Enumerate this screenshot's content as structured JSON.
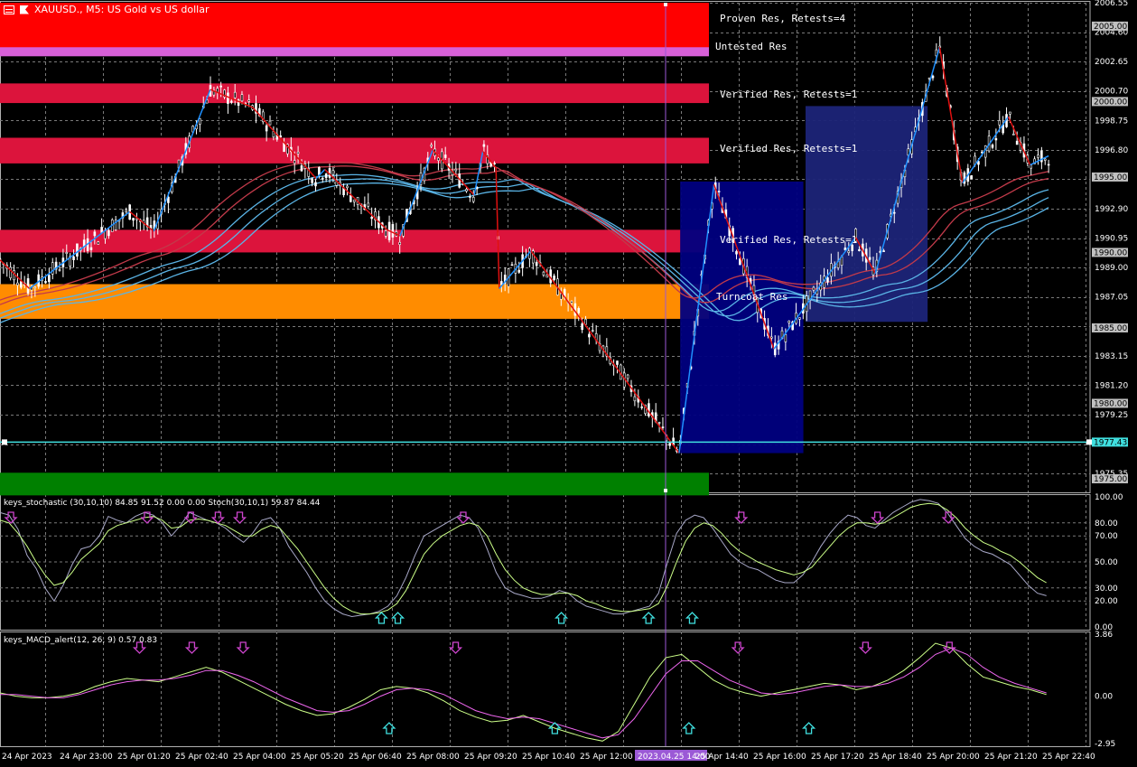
{
  "window": {
    "title": "XAUUSD., M5:  US Gold vs US dollar"
  },
  "colors": {
    "background": "#000000",
    "grid": "#7a7a7a",
    "candle": "#ffffff",
    "zigzag_up": "#1e90ff",
    "zigzag_down": "#e01010",
    "ma_blue": "#5ab4e6",
    "ma_red": "#c23a4a",
    "ma_magenta": "#d03aa0",
    "ma_teal": "#2aa89a",
    "proven_res": "#ff0000",
    "untested_res": "#d860d8",
    "verified_res": "#dc143c",
    "turncoat": "#ff8c00",
    "support_green": "#008000",
    "box_dark": "#00007f",
    "box_light": "#1c2478",
    "hline": "#40e0e0",
    "vline": "#9b59d6",
    "stoch_main": "#a8a8c8",
    "stoch_signal": "#ccff88",
    "arrow_down": "#cc44cc",
    "arrow_up": "#40e0e0",
    "macd_main": "#ccff88",
    "macd_signal": "#ee66ee"
  },
  "chart_data": [
    {
      "type": "candlestick",
      "symbol": "XAUUSD.",
      "timeframe": "M5",
      "ylim": [
        1974.1,
        2006.55
      ],
      "y_ticks": [
        "2006.55",
        "2004.60",
        "2002.65",
        "2000.70",
        "1998.75",
        "1996.80",
        "1994.85",
        "1992.90",
        "1990.95",
        "1989.00",
        "1987.05",
        "1985.10",
        "1983.15",
        "1981.20",
        "1979.25",
        "1977.30",
        "1975.35"
      ],
      "y_ticks_visible": [
        "2006.55",
        "2004.60",
        "2002.65",
        "2000.70",
        "1998.75",
        "1996.80",
        "1992.90",
        "1990.95",
        "1989.00",
        "1987.05",
        "1983.15",
        "1981.20",
        "1979.25",
        "1975.35"
      ],
      "price_labels": [
        {
          "text": "2005.00",
          "value": 2005.0,
          "style": "grey"
        },
        {
          "text": "2000.00",
          "value": 2000.0,
          "style": "grey"
        },
        {
          "text": "1995.00",
          "value": 1995.0,
          "style": "grey"
        },
        {
          "text": "1990.00",
          "value": 1990.0,
          "style": "grey"
        },
        {
          "text": "1985.00",
          "value": 1985.0,
          "style": "grey"
        },
        {
          "text": "1980.00",
          "value": 1980.0,
          "style": "grey"
        },
        {
          "text": "1977.43",
          "value": 1977.43,
          "style": "cyan"
        },
        {
          "text": "1975.00",
          "value": 1975.0,
          "style": "grey"
        }
      ],
      "zones": [
        {
          "label": "Proven Res, Retests=4",
          "from": 2003.1,
          "to": 2006.55,
          "color": "#ff0000"
        },
        {
          "label": "Untested Res",
          "from": 2003.0,
          "to": 2003.6,
          "color": "#d860d8"
        },
        {
          "label": "Verified Res, Retests=1",
          "from": 1999.9,
          "to": 2001.2,
          "color": "#dc143c"
        },
        {
          "label": "Verified Res, Retests=1",
          "from": 1995.9,
          "to": 1997.6,
          "color": "#dc143c"
        },
        {
          "label": "Verified Res, Retests=1",
          "from": 1990.0,
          "to": 1991.5,
          "color": "#dc143c"
        },
        {
          "label": "Turncoat Res",
          "from": 1985.6,
          "to": 1987.9,
          "color": "#ff8c00"
        },
        {
          "label": "",
          "from": 1973.9,
          "to": 1975.4,
          "color": "#008000"
        }
      ],
      "hline": {
        "value": 1977.43,
        "label": "1977.43"
      },
      "zigzag": [
        [
          1985.3,
          1986.3
        ],
        [
          1990.3,
          1987.8
        ],
        [
          1986.8,
          1989.3
        ],
        [
          1990.8,
          1991.7
        ],
        [
          1992.0,
          1993.0
        ],
        [
          1990.9,
          1992.0
        ],
        [
          1986.7,
          1988.1
        ],
        [
          1993.3,
          1995.3
        ],
        [
          1990.5,
          1991.3
        ],
        [
          1996.6,
          1997.1
        ],
        [
          1995.0,
          1994.3
        ]
      ],
      "zigzag_points": [
        {
          "t": 0.0,
          "v": 1989.5
        },
        {
          "t": 0.027,
          "v": 1987.6
        },
        {
          "t": 0.119,
          "v": 1992.7
        },
        {
          "t": 0.141,
          "v": 1991.4
        },
        {
          "t": 0.193,
          "v": 2000.8
        },
        {
          "t": 0.232,
          "v": 1999.6
        },
        {
          "t": 0.29,
          "v": 1994.9
        },
        {
          "t": 0.298,
          "v": 1995.5
        },
        {
          "t": 0.355,
          "v": 1991.5
        },
        {
          "t": 0.367,
          "v": 1991.1
        },
        {
          "t": 0.397,
          "v": 1996.8
        },
        {
          "t": 0.435,
          "v": 1993.8
        },
        {
          "t": 0.443,
          "v": 1996.7
        },
        {
          "t": 0.455,
          "v": 1995.6
        },
        {
          "t": 0.458,
          "v": 1987.6
        },
        {
          "t": 0.487,
          "v": 1990.1
        },
        {
          "t": 0.623,
          "v": 1976.7
        },
        {
          "t": 0.655,
          "v": 1994.5
        },
        {
          "t": 0.71,
          "v": 1983.6
        },
        {
          "t": 0.785,
          "v": 1991.0
        },
        {
          "t": 0.803,
          "v": 1988.6
        },
        {
          "t": 0.862,
          "v": 2003.6
        },
        {
          "t": 0.883,
          "v": 1994.6
        },
        {
          "t": 0.925,
          "v": 1999.0
        },
        {
          "t": 0.945,
          "v": 1995.8
        },
        {
          "t": 0.962,
          "v": 1996.4
        }
      ],
      "boxes": [
        {
          "from": "2023.04.25 14:00",
          "t0": 0.624,
          "t1": 0.737,
          "low": 1976.7,
          "high": 1994.7,
          "color": "#00007f"
        },
        {
          "t0": 0.739,
          "t1": 0.851,
          "low": 1985.4,
          "high": 1999.7,
          "color": "#1c2478"
        }
      ],
      "vline": {
        "t": 0.586,
        "label": "2023.04.25 14:00"
      }
    },
    {
      "type": "line",
      "name": "keys_stochastic (30,10,10) 84.85 91.52 0.00 0.00 Stoch(30,10,1) 59.87 84.44",
      "ylim": [
        0,
        100
      ],
      "y_ticks": [
        "100.00",
        "80.00",
        "70.00",
        "50.00",
        "30.00",
        "20.00",
        "0.00"
      ],
      "main": [
        88,
        86,
        75,
        55,
        45,
        30,
        20,
        32,
        48,
        60,
        62,
        70,
        85,
        82,
        80,
        85,
        88,
        86,
        80,
        70,
        78,
        88,
        85,
        82,
        80,
        76,
        70,
        65,
        72,
        82,
        84,
        76,
        62,
        52,
        42,
        30,
        20,
        14,
        10,
        8,
        9,
        10,
        12,
        16,
        24,
        38,
        55,
        70,
        74,
        78,
        82,
        86,
        84,
        76,
        60,
        42,
        30,
        26,
        24,
        22,
        22,
        24,
        28,
        26,
        20,
        16,
        14,
        12,
        10,
        10,
        12,
        14,
        16,
        26,
        50,
        72,
        82,
        86,
        84,
        76,
        66,
        56,
        50,
        46,
        44,
        40,
        36,
        34,
        34,
        40,
        50,
        62,
        72,
        80,
        86,
        84,
        78,
        76,
        82,
        88,
        92,
        96,
        98,
        97,
        95,
        88,
        78,
        68,
        62,
        58,
        56,
        52,
        48,
        40,
        32,
        26,
        24
      ],
      "signal": [
        82,
        80,
        72,
        62,
        50,
        40,
        32,
        34,
        42,
        52,
        58,
        64,
        74,
        78,
        80,
        82,
        84,
        85,
        82,
        76,
        77,
        82,
        83,
        82,
        80,
        78,
        74,
        70,
        70,
        75,
        78,
        76,
        68,
        60,
        50,
        40,
        30,
        22,
        16,
        12,
        10,
        10,
        11,
        13,
        18,
        28,
        42,
        56,
        64,
        70,
        74,
        78,
        80,
        78,
        70,
        56,
        44,
        36,
        30,
        27,
        25,
        25,
        26,
        26,
        24,
        20,
        18,
        15,
        13,
        12,
        12,
        13,
        14,
        18,
        32,
        50,
        66,
        76,
        80,
        78,
        72,
        64,
        58,
        54,
        50,
        47,
        44,
        42,
        40,
        42,
        46,
        54,
        62,
        70,
        76,
        80,
        80,
        79,
        80,
        84,
        88,
        92,
        94,
        95,
        94,
        90,
        84,
        76,
        70,
        65,
        62,
        58,
        55,
        50,
        44,
        38,
        34
      ],
      "arrows_down": [
        0.01,
        0.135,
        0.175,
        0.2,
        0.22,
        0.425,
        0.68,
        0.805,
        0.87
      ],
      "arrows_up": [
        0.35,
        0.365,
        0.515,
        0.595,
        0.635
      ]
    },
    {
      "type": "line",
      "name": "keys_MACD_alert(12, 26, 9) 0.57 0.83",
      "ylim": [
        -2.95,
        3.86
      ],
      "y_ticks": [
        "3.86",
        "0.00",
        "-2.95"
      ],
      "main": [
        0.2,
        0.0,
        -0.1,
        -0.1,
        0.0,
        0.2,
        0.6,
        0.9,
        1.1,
        1.0,
        0.9,
        1.2,
        1.5,
        1.8,
        1.5,
        1.0,
        0.5,
        0.0,
        -0.5,
        -0.9,
        -1.2,
        -1.1,
        -0.7,
        -0.2,
        0.4,
        0.6,
        0.5,
        0.2,
        -0.3,
        -0.9,
        -1.3,
        -1.6,
        -1.5,
        -1.2,
        -1.6,
        -2.0,
        -2.3,
        -2.6,
        -2.8,
        -2.2,
        -0.5,
        1.2,
        2.4,
        2.6,
        1.8,
        1.0,
        0.5,
        0.2,
        0.0,
        0.2,
        0.4,
        0.6,
        0.8,
        0.7,
        0.4,
        0.6,
        1.0,
        1.6,
        2.4,
        3.3,
        3.0,
        2.0,
        1.2,
        0.9,
        0.6,
        0.4,
        0.1
      ],
      "signal": [
        0.1,
        0.1,
        0.0,
        -0.1,
        -0.1,
        0.1,
        0.4,
        0.7,
        0.9,
        1.0,
        1.0,
        1.1,
        1.3,
        1.6,
        1.6,
        1.3,
        0.9,
        0.4,
        -0.1,
        -0.5,
        -0.9,
        -1.0,
        -0.9,
        -0.5,
        0.0,
        0.4,
        0.5,
        0.4,
        0.1,
        -0.4,
        -0.9,
        -1.2,
        -1.4,
        -1.3,
        -1.4,
        -1.7,
        -2.0,
        -2.3,
        -2.6,
        -2.4,
        -1.4,
        0.0,
        1.4,
        2.2,
        2.2,
        1.6,
        1.0,
        0.6,
        0.2,
        0.1,
        0.2,
        0.4,
        0.6,
        0.7,
        0.6,
        0.6,
        0.8,
        1.2,
        1.8,
        2.6,
        3.0,
        2.6,
        1.8,
        1.2,
        0.8,
        0.5,
        0.2
      ],
      "arrows_down": [
        0.128,
        0.176,
        0.223,
        0.418,
        0.677,
        0.794,
        0.871
      ],
      "arrows_up": [
        0.357,
        0.509,
        0.742,
        0.632
      ]
    }
  ],
  "x_axis": {
    "labels": [
      "24 Apr 2023",
      "24 Apr 23:00",
      "25 Apr 01:20",
      "25 Apr 02:40",
      "25 Apr 04:00",
      "25 Apr 05:20",
      "25 Apr 06:40",
      "25 Apr 08:00",
      "25 Apr 09:20",
      "25 Apr 10:40",
      "25 Apr 12:00",
      "2023.04.25 14:00",
      "25 Apr 14:40",
      "25 Apr 16:00",
      "25 Apr 17:20",
      "25 Apr 18:40",
      "25 Apr 20:00",
      "25 Apr 21:20",
      "25 Apr 22:40"
    ],
    "highlight": "2023.04.25 14:00"
  }
}
